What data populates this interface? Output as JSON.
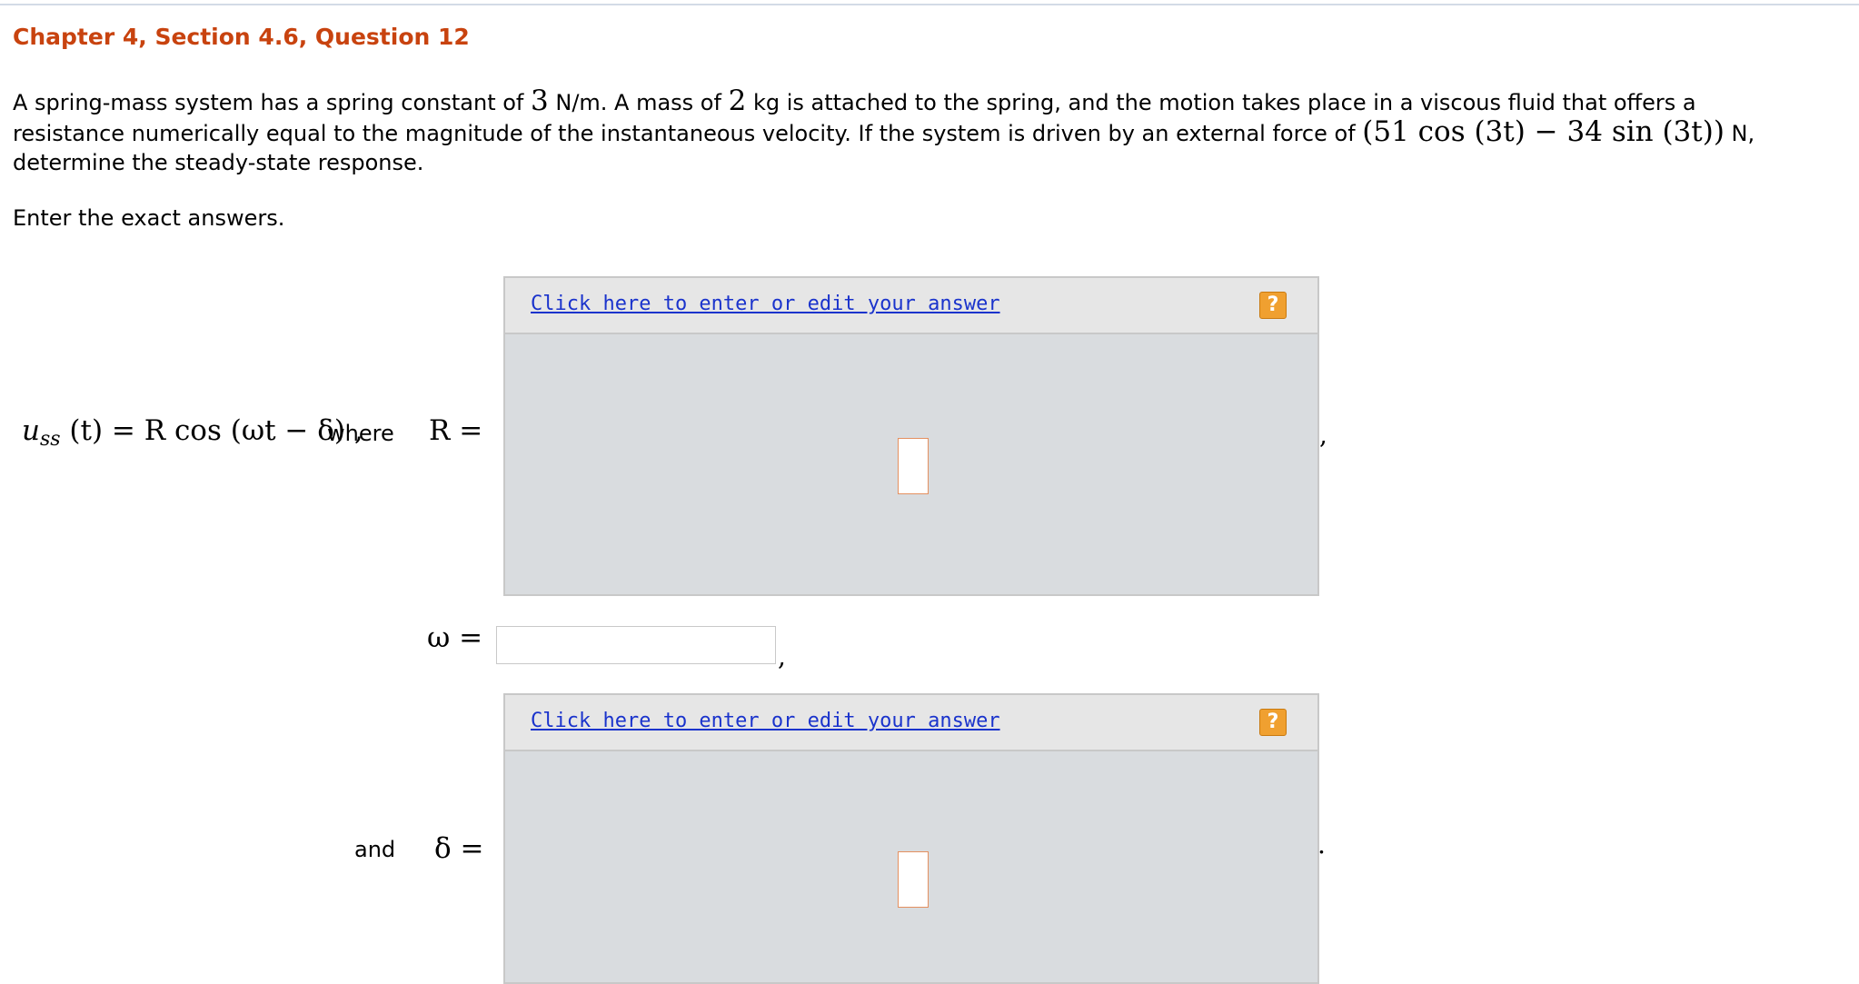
{
  "header": {
    "title": "Chapter 4, Section 4.6, Question 12"
  },
  "problem": {
    "line1_a": "A spring-mass system has a spring constant of ",
    "spring_constant": "3",
    "line1_b": " N/m. A mass of ",
    "mass": "2",
    "line1_c": " kg is attached to the spring, and the motion takes place in a viscous fluid that offers a",
    "line2_a": "resistance numerically equal to the magnitude of the instantaneous velocity. If the system is driven by an external force of ",
    "force_expr": "(51 cos (3t) − 34 sin (3t))",
    "line2_b": " N,",
    "line3": "determine the steady-state response.",
    "instruction": "Enter the exact answers."
  },
  "answer": {
    "lhs_u": "u",
    "lhs_sub": "ss",
    "lhs_rest": " (t) = R cos (ωt − δ) ,",
    "where_text": "where",
    "r_label": "R =",
    "omega_label": "ω =",
    "delta_label": "δ =",
    "and_text": "and",
    "r_punct": ",",
    "omega_punct": ",",
    "delta_punct": ".",
    "omega_value": ""
  },
  "editors": {
    "r": {
      "link_label": "Click here to enter or edit your answer",
      "help_label": "?"
    },
    "delta": {
      "link_label": "Click here to enter or edit your answer",
      "help_label": "?"
    }
  },
  "colors": {
    "title": "#c8430f",
    "link": "#1a33cc",
    "help_button": "#f0a030",
    "editor_bg": "#d9dcdf",
    "editor_bar": "#e6e6e6",
    "placeholder_border": "#e49060"
  },
  "icons": {
    "help": "question-mark-icon"
  }
}
